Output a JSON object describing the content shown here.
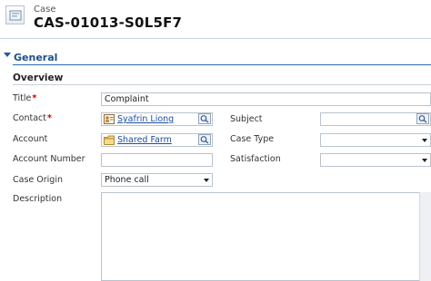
{
  "header": {
    "entity_type": "Case",
    "record_id": "CAS-01013-S0L5F7",
    "icon": "case-form-icon"
  },
  "section": {
    "title": "General",
    "toggle_icon": "collapse-triangle-icon",
    "subsection_title": "Overview"
  },
  "fields": {
    "title": {
      "label": "Title",
      "required_mark": "*",
      "value": "Complaint"
    },
    "contact": {
      "label": "Contact",
      "required_mark": "*",
      "value": "Syafrin Liong",
      "icon": "contact-card-icon",
      "lookup_icon": "lookup-search-icon"
    },
    "account": {
      "label": "Account",
      "value": "Shared Farm",
      "icon": "account-folder-icon",
      "lookup_icon": "lookup-search-icon"
    },
    "account_number": {
      "label": "Account Number",
      "value": ""
    },
    "case_origin": {
      "label": "Case Origin",
      "value": "Phone call"
    },
    "description": {
      "label": "Description",
      "value": ""
    },
    "subject": {
      "label": "Subject",
      "value": "",
      "lookup_icon": "lookup-search-icon"
    },
    "case_type": {
      "label": "Case Type",
      "value": ""
    },
    "satisfaction": {
      "label": "Satisfaction",
      "value": ""
    }
  },
  "colors": {
    "section_title": "#1f4f8a",
    "link": "#1a4fa0",
    "required": "#cc0000",
    "field_border": "#b9c2cc"
  }
}
